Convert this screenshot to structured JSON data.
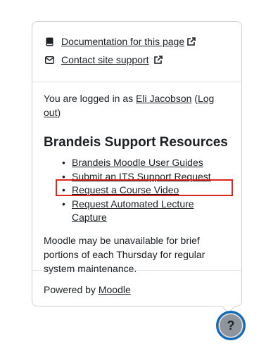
{
  "footer_popover": {
    "links": [
      {
        "label": "Documentation for this page",
        "icon": "book-icon"
      },
      {
        "label": "Contact site support",
        "icon": "envelope-icon"
      }
    ],
    "login": {
      "prefix": "You are logged in as ",
      "user": "Eli Jacobson",
      "open_paren": " (",
      "logout": "Log out",
      "close_paren": ")"
    },
    "resources": {
      "heading": "Brandeis Support Resources",
      "items": [
        "Brandeis Moodle User Guides",
        "Submit an ITS Support Request",
        "Request a Course Video",
        "Request Automated Lecture Capture"
      ]
    },
    "notice": "Moodle may be unavailable for brief portions of each Thursday for regular system maintenance.",
    "powered_by": {
      "prefix": "Powered by ",
      "link": "Moodle"
    }
  },
  "help_button": {
    "label": "?"
  },
  "colors": {
    "highlight": "#e0261c",
    "help_button_border": "#0f6cbf",
    "help_button_fill": "#8e959c"
  }
}
